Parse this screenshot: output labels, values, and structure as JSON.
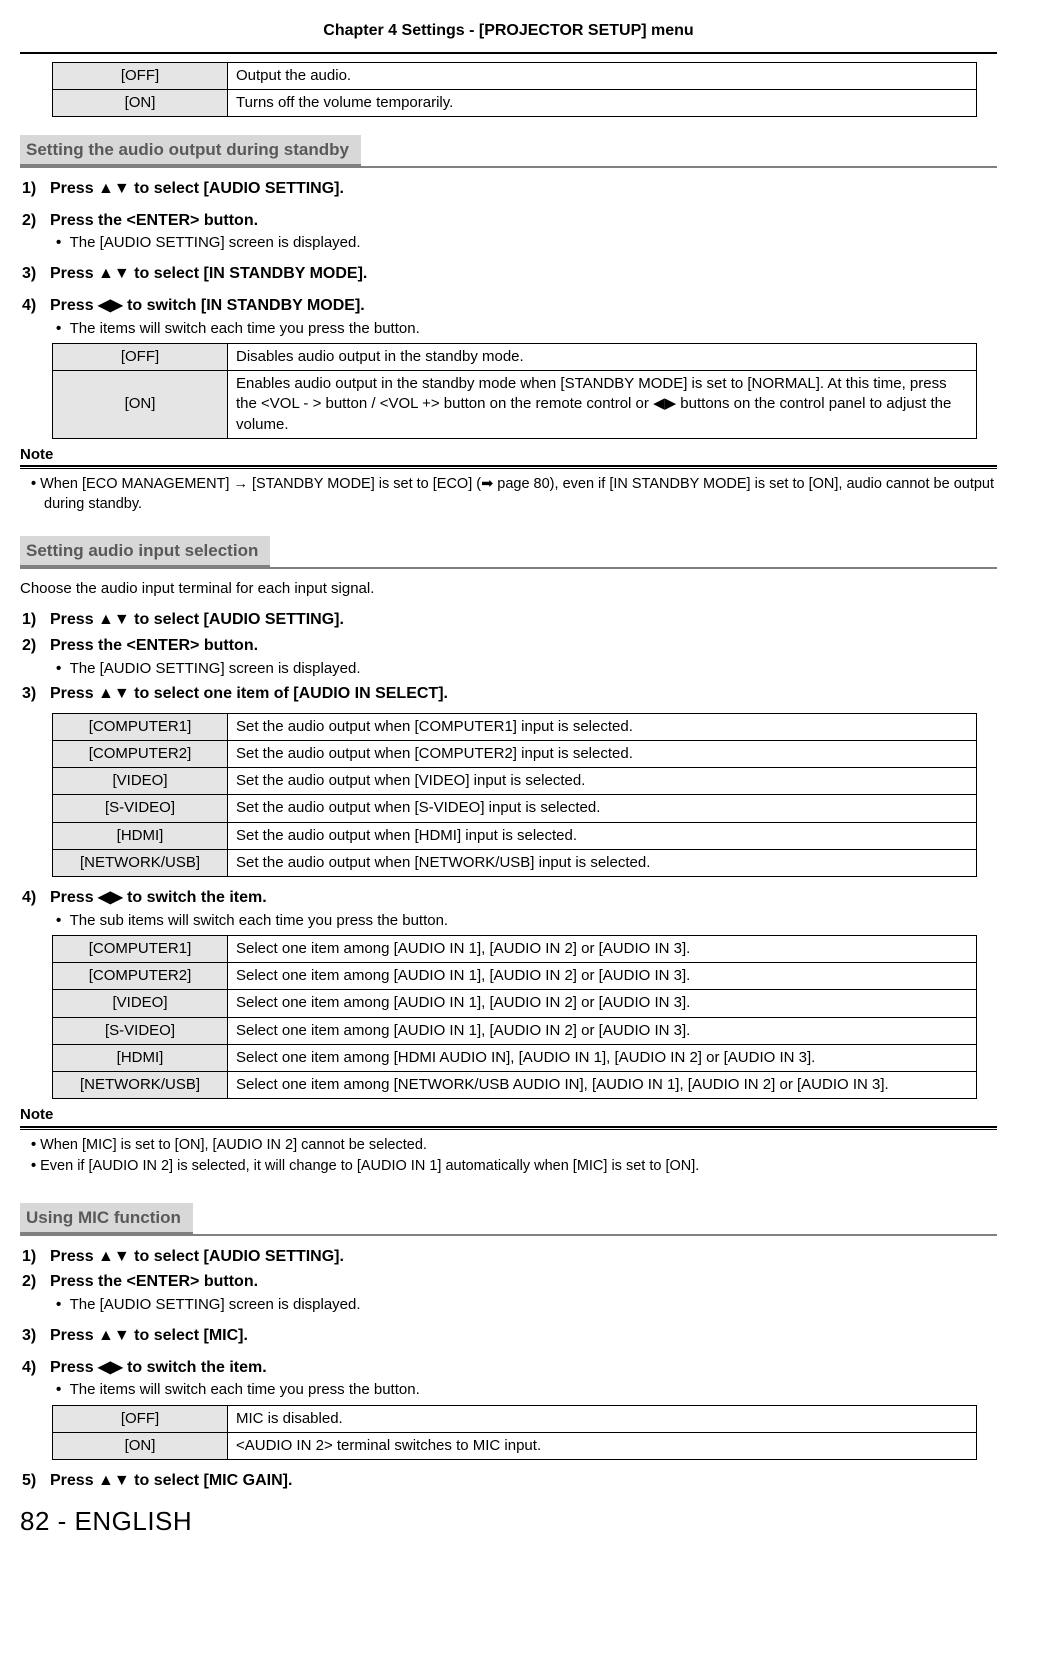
{
  "chapter": "Chapter 4   Settings - [PROJECTOR SETUP] menu",
  "table_mute": {
    "rows": [
      {
        "label": "[OFF]",
        "desc": "Output the audio."
      },
      {
        "label": "[ON]",
        "desc": "Turns off the volume temporarily."
      }
    ]
  },
  "sec1": {
    "heading": "Setting the audio output during standby",
    "step1": "Press ▲▼ to select [AUDIO SETTING].",
    "step2": "Press the <ENTER> button.",
    "step2_sub": "The [AUDIO SETTING] screen is displayed.",
    "step3": "Press ▲▼ to select [IN STANDBY MODE].",
    "step4": "Press ◀▶ to switch [IN STANDBY MODE].",
    "step4_sub": "The items will switch each time you press the button.",
    "table": {
      "rows": [
        {
          "label": "[OFF]",
          "desc": "Disables audio output in the standby mode."
        },
        {
          "label": "[ON]",
          "desc": "Enables audio output in the standby mode when [STANDBY MODE] is set to [NORMAL]. At this time, press the <VOL - > button / <VOL +> button on the remote control or ◀▶ buttons on the control panel to adjust the volume."
        }
      ]
    },
    "note1": "When [ECO MANAGEMENT] → [STANDBY MODE] is set to [ECO] (➡ page 80), even if [IN STANDBY MODE] is set to [ON], audio cannot be output during standby."
  },
  "sec2": {
    "heading": "Setting audio input selection",
    "intro": "Choose the audio input terminal for each input signal.",
    "step1": "Press ▲▼ to select [AUDIO SETTING].",
    "step2": "Press the <ENTER> button.",
    "step2_sub": "The [AUDIO SETTING] screen is displayed.",
    "step3": "Press ▲▼ to select one item of [AUDIO IN SELECT].",
    "table_a": {
      "rows": [
        {
          "label": "[COMPUTER1]",
          "desc": "Set the audio output when [COMPUTER1] input is selected."
        },
        {
          "label": "[COMPUTER2]",
          "desc": "Set the audio output when [COMPUTER2] input is selected."
        },
        {
          "label": "[VIDEO]",
          "desc": "Set the audio output when [VIDEO] input is selected."
        },
        {
          "label": "[S-VIDEO]",
          "desc": "Set the audio output when [S-VIDEO] input is selected."
        },
        {
          "label": "[HDMI]",
          "desc": "Set the audio output when [HDMI] input is selected."
        },
        {
          "label": "[NETWORK/USB]",
          "desc": "Set the audio output when [NETWORK/USB] input is selected."
        }
      ]
    },
    "step4": "Press ◀▶ to switch the item.",
    "step4_sub": "The sub items will switch each time you press the button.",
    "table_b": {
      "rows": [
        {
          "label": "[COMPUTER1]",
          "desc": "Select one item among [AUDIO IN 1], [AUDIO IN 2] or [AUDIO IN 3]."
        },
        {
          "label": "[COMPUTER2]",
          "desc": "Select one item among [AUDIO IN 1], [AUDIO IN 2] or [AUDIO IN 3]."
        },
        {
          "label": "[VIDEO]",
          "desc": "Select one item among [AUDIO IN 1], [AUDIO IN 2] or [AUDIO IN 3]."
        },
        {
          "label": "[S-VIDEO]",
          "desc": "Select one item among [AUDIO IN 1], [AUDIO IN 2] or [AUDIO IN 3]."
        },
        {
          "label": "[HDMI]",
          "desc": "Select one item among [HDMI AUDIO IN], [AUDIO IN 1], [AUDIO IN 2] or [AUDIO IN 3]."
        },
        {
          "label": "[NETWORK/USB]",
          "desc": "Select one item among [NETWORK/USB AUDIO IN], [AUDIO IN 1], [AUDIO IN 2] or [AUDIO IN 3]."
        }
      ]
    },
    "note1": "When [MIC] is set to [ON], [AUDIO IN 2] cannot be selected.",
    "note2": "Even if [AUDIO IN 2] is selected, it will change to [AUDIO IN 1] automatically when [MIC] is set to [ON]."
  },
  "sec3": {
    "heading": "Using MIC function",
    "step1": "Press ▲▼ to select [AUDIO SETTING].",
    "step2": "Press the <ENTER> button.",
    "step2_sub": "The [AUDIO SETTING] screen is displayed.",
    "step3": "Press ▲▼ to select [MIC].",
    "step4": "Press ◀▶ to switch the item.",
    "step4_sub": "The items will switch each time you press the button.",
    "table": {
      "rows": [
        {
          "label": "[OFF]",
          "desc": "MIC is disabled."
        },
        {
          "label": "[ON]",
          "desc": "<AUDIO IN 2> terminal switches to MIC input."
        }
      ]
    },
    "step5": "Press ▲▼ to select [MIC GAIN]."
  },
  "labels": {
    "note": "Note"
  },
  "footer": "82 - ENGLISH"
}
